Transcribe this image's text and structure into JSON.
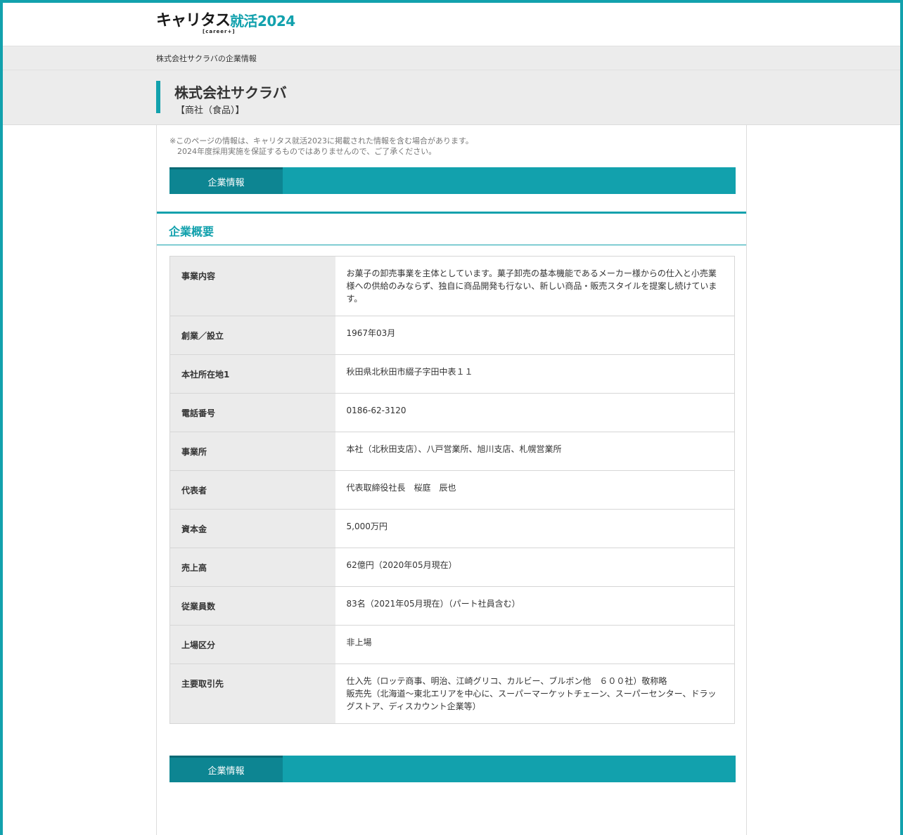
{
  "header": {
    "logo_main": "キャリタス",
    "logo_sub": "[career+]",
    "logo_accent": "就活2024"
  },
  "breadcrumb": "株式会社サクラバの企業情報",
  "company": {
    "name": "株式会社サクラバ",
    "industry": "【商社（食品）】"
  },
  "notice": {
    "line1": "※このページの情報は、キャリタス就活2023に掲載された情報を含む場合があります。",
    "line2": "2024年度採用実施を保証するものではありませんので、ご了承ください。"
  },
  "tabs": {
    "top_label": "企業情報",
    "bottom_label": "企業情報"
  },
  "section": {
    "title": "企業概要"
  },
  "table": [
    {
      "label": "事業内容",
      "value": "お菓子の卸売事業を主体としています。菓子卸売の基本機能であるメーカー様からの仕入と小売業様への供給のみならず、独自に商品開発も行ない、新しい商品・販売スタイルを提案し続けています。"
    },
    {
      "label": "創業／設立",
      "value": "1967年03月"
    },
    {
      "label": "本社所在地1",
      "value": "秋田県北秋田市綴子字田中表１１"
    },
    {
      "label": "電話番号",
      "value": "0186-62-3120"
    },
    {
      "label": "事業所",
      "value": "本社（北秋田支店）、八戸営業所、旭川支店、札幌営業所"
    },
    {
      "label": "代表者",
      "value": "代表取締役社長　桜庭　辰也"
    },
    {
      "label": "資本金",
      "value": "5,000万円"
    },
    {
      "label": "売上高",
      "value": "62億円（2020年05月現在）"
    },
    {
      "label": "従業員数",
      "value": "83名（2021年05月現在）（パート社員含む）"
    },
    {
      "label": "上場区分",
      "value": "非上場"
    },
    {
      "label": "主要取引先",
      "value": "仕入先（ロッテ商事、明治、江崎グリコ、カルビー、ブルボン他　６００社）敬称略\n販売先（北海道～東北エリアを中心に、スーパーマーケットチェーン、スーパーセンター、ドラッグストア、ディスカウント企業等）"
    }
  ],
  "colors": {
    "accent": "#12a1ad",
    "tab_active": "#0d8592",
    "label_bg": "#ebebeb"
  }
}
